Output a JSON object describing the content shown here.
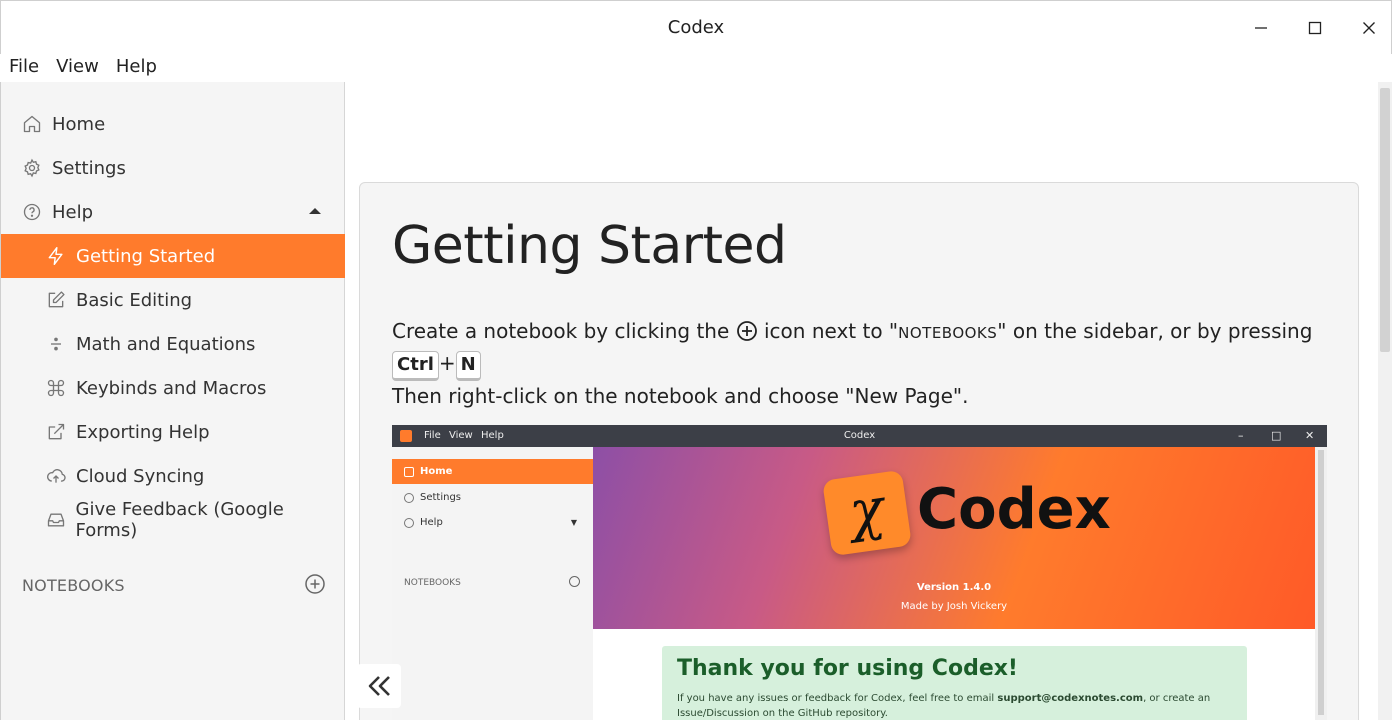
{
  "window": {
    "title": "Codex",
    "controls": [
      "minimize-icon",
      "maximize-icon",
      "close-icon"
    ]
  },
  "menubar": {
    "items": [
      "File",
      "View",
      "Help"
    ]
  },
  "sidebar": {
    "items": [
      {
        "label": "Home",
        "icon": "home-icon"
      },
      {
        "label": "Settings",
        "icon": "gear-icon"
      },
      {
        "label": "Help",
        "icon": "help-circle-icon",
        "expanded": true
      }
    ],
    "help_items": [
      {
        "label": "Getting Started",
        "icon": "lightning-icon",
        "active": true
      },
      {
        "label": "Basic Editing",
        "icon": "edit-icon"
      },
      {
        "label": "Math and Equations",
        "icon": "divide-icon"
      },
      {
        "label": "Keybinds and Macros",
        "icon": "command-icon"
      },
      {
        "label": "Exporting Help",
        "icon": "external-link-icon"
      },
      {
        "label": "Cloud Syncing",
        "icon": "cloud-upload-icon"
      },
      {
        "label": "Give Feedback (Google Forms)",
        "icon": "inbox-icon"
      }
    ],
    "notebooks_label": "NOTEBOOKS",
    "accent": "#ff7b2c"
  },
  "main": {
    "title": "Getting Started",
    "para_1": "Create a notebook by clicking the",
    "para_2": "icon next to \"",
    "para_notebooks": "NOTEBOOKS",
    "para_3": "\" on the sidebar, or by pressing",
    "kbd_ctrl": "Ctrl",
    "kbd_plus": "+",
    "kbd_n": "N",
    "para_line2": "Then right-click on the notebook and choose \"New Page\"."
  },
  "screenshot": {
    "menu": [
      "File",
      "View",
      "Help"
    ],
    "title": "Codex",
    "side_items": [
      "Home",
      "Settings",
      "Help"
    ],
    "notebooks_label": "NOTEBOOKS",
    "brand": "Codex",
    "brand_mark": "χ",
    "version": "Version 1.4.0",
    "made_by": "Made by Josh Vickery",
    "thanks_title": "Thank you for using Codex!",
    "thanks_text_1": "If you have any issues or feedback for Codex, feel free to email ",
    "thanks_email": "support@codexnotes.com",
    "thanks_text_2": ", or create an Issue/Discussion on the GitHub repository."
  }
}
